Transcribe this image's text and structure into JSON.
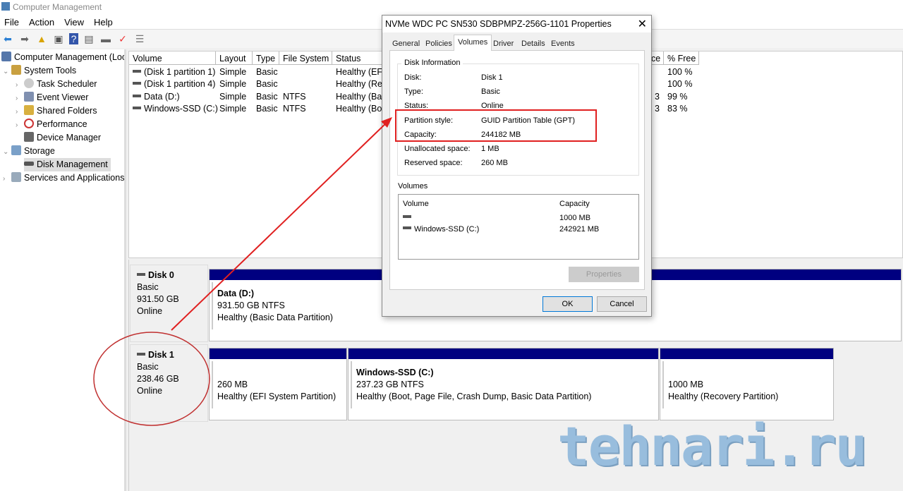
{
  "window": {
    "title": "Computer Management"
  },
  "menu": [
    "File",
    "Action",
    "View",
    "Help"
  ],
  "tree": {
    "root": "Computer Management (Loca",
    "items": [
      {
        "label": "System Tools",
        "level": 1
      },
      {
        "label": "Task Scheduler",
        "level": 2
      },
      {
        "label": "Event Viewer",
        "level": 2
      },
      {
        "label": "Shared Folders",
        "level": 2
      },
      {
        "label": "Performance",
        "level": 2
      },
      {
        "label": "Device Manager",
        "level": 2
      },
      {
        "label": "Storage",
        "level": 1
      },
      {
        "label": "Disk Management",
        "level": 2,
        "selected": true
      },
      {
        "label": "Services and Applications",
        "level": 1
      }
    ]
  },
  "volumes": {
    "headers": [
      "Volume",
      "Layout",
      "Type",
      "File System",
      "Status",
      "ce",
      "% Free"
    ],
    "rows": [
      {
        "volume": "(Disk 1 partition 1)",
        "layout": "Simple",
        "type": "Basic",
        "fs": "",
        "status": "Healthy (EFI",
        "cap": "",
        "free": "100 %"
      },
      {
        "volume": "(Disk 1 partition 4)",
        "layout": "Simple",
        "type": "Basic",
        "fs": "",
        "status": "Healthy (Rec",
        "cap": "",
        "free": "100 %"
      },
      {
        "volume": "Data (D:)",
        "layout": "Simple",
        "type": "Basic",
        "fs": "NTFS",
        "status": "Healthy (Bas",
        "cap": "3",
        "free": "99 %"
      },
      {
        "volume": "Windows-SSD (C:)",
        "layout": "Simple",
        "type": "Basic",
        "fs": "NTFS",
        "status": "Healthy (Boo",
        "cap": "3",
        "free": "83 %"
      }
    ]
  },
  "disks": [
    {
      "name": "Disk 0",
      "type": "Basic",
      "size": "931.50 GB",
      "status": "Online",
      "partitions": [
        {
          "name": "Data  (D:)",
          "size": "931.50 GB NTFS",
          "status": "Healthy (Basic Data Partition)"
        }
      ]
    },
    {
      "name": "Disk 1",
      "type": "Basic",
      "size": "238.46 GB",
      "status": "Online",
      "partitions": [
        {
          "name": "",
          "size": "260 MB",
          "status": "Healthy (EFI System Partition)"
        },
        {
          "name": "Windows-SSD  (C:)",
          "size": "237.23 GB NTFS",
          "status": "Healthy (Boot, Page File, Crash Dump, Basic Data Partition)"
        },
        {
          "name": "",
          "size": "1000 MB",
          "status": "Healthy (Recovery Partition)"
        }
      ]
    }
  ],
  "dialog": {
    "title": "NVMe WDC PC SN530 SDBPMPZ-256G-1101 Properties",
    "tabs": [
      "General",
      "Policies",
      "Volumes",
      "Driver",
      "Details",
      "Events"
    ],
    "active_tab": "Volumes",
    "disk_info_label": "Disk Information",
    "info": [
      {
        "label": "Disk:",
        "value": "Disk 1"
      },
      {
        "label": "Type:",
        "value": "Basic"
      },
      {
        "label": "Status:",
        "value": "Online"
      },
      {
        "label": "Partition style:",
        "value": "GUID Partition Table (GPT)"
      },
      {
        "label": "Capacity:",
        "value": "244182 MB"
      },
      {
        "label": "Unallocated space:",
        "value": "1 MB"
      },
      {
        "label": "Reserved space:",
        "value": "260 MB"
      }
    ],
    "volumes_label": "Volumes",
    "vol_headers": [
      "Volume",
      "Capacity"
    ],
    "vol_rows": [
      {
        "name": "",
        "capacity": "1000 MB"
      },
      {
        "name": "Windows-SSD (C:)",
        "capacity": "242921 MB"
      }
    ],
    "properties_btn": "Properties",
    "ok_btn": "OK",
    "cancel_btn": "Cancel"
  },
  "watermark": "tehnari.ru",
  "colors": {
    "annotation": "#e02020",
    "partition_bar": "#000080"
  }
}
